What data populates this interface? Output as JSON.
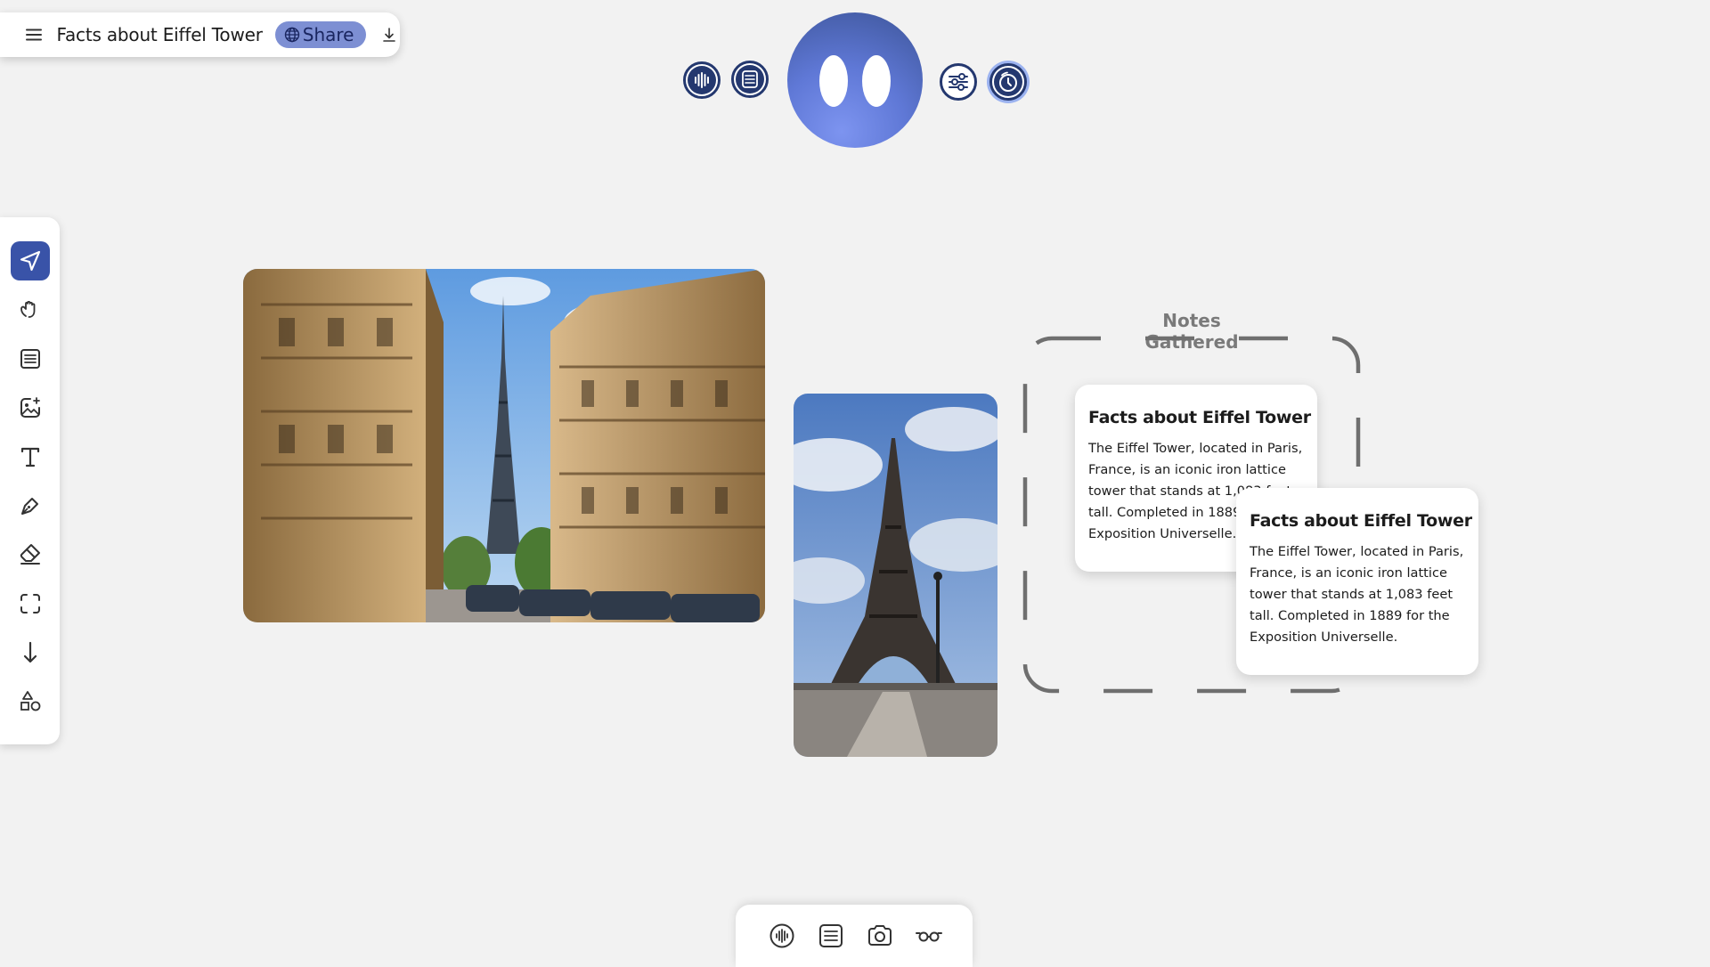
{
  "header": {
    "title": "Facts about Eiffel Tower",
    "share_label": "Share",
    "menu_icon": "hamburger-icon",
    "share_icon": "globe-icon",
    "download_icon": "download-icon"
  },
  "top_controls": {
    "left_buttons": [
      "voice-wave-icon",
      "notes-list-icon"
    ],
    "right_buttons": [
      "sliders-icon",
      "timer-icon"
    ],
    "assistant": "assistant-avatar"
  },
  "left_toolbar": {
    "tools": [
      "pointer-icon",
      "hand-icon",
      "note-icon",
      "image-add-icon",
      "text-icon",
      "pen-icon",
      "eraser-icon",
      "frame-select-icon",
      "arrow-down-icon",
      "shapes-icon"
    ],
    "active_tool": "pointer-icon"
  },
  "canvas": {
    "photos": [
      "eiffel-street-photo",
      "eiffel-bridge-photo"
    ],
    "group": {
      "label": "Notes Gathered"
    },
    "notes": [
      {
        "title": "Facts about Eiffel Tower",
        "body": "The Eiffel Tower, located in Paris, France, is an iconic iron lattice tower that stands at 1,083 feet tall. Completed in 1889 for the Exposition Universelle."
      },
      {
        "title": "Facts about Eiffel Tower",
        "body": "The Eiffel Tower, located in Paris, France, is an iconic iron lattice tower that stands at 1,083 feet tall. Completed in 1889 for the Exposition Universelle."
      }
    ]
  },
  "bottom_dock": {
    "buttons": [
      "voice-wave-icon",
      "notes-list-icon",
      "camera-icon",
      "glasses-icon"
    ]
  },
  "colors": {
    "accent": "#3953a8",
    "share_bg": "#7d8fd3",
    "dark_navy": "#24386f",
    "canvas_bg": "#f2f2f2"
  }
}
